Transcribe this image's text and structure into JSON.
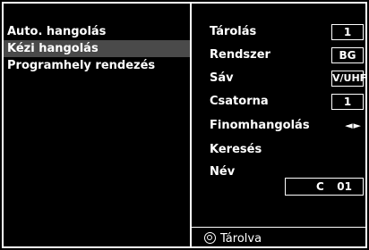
{
  "left_menu": {
    "items": [
      {
        "label": "Auto. hangolás",
        "selected": false
      },
      {
        "label": "Kézi hangolás",
        "selected": true
      },
      {
        "label": "Programhely rendezés",
        "selected": false
      }
    ]
  },
  "settings": {
    "storage": {
      "label": "Tárolás",
      "value": "1"
    },
    "system": {
      "label": "Rendszer",
      "value": "BG"
    },
    "band": {
      "label": "Sáv",
      "value": "V/UHF"
    },
    "channel": {
      "label": "Csatorna",
      "value": "1"
    },
    "fine_tuning": {
      "label": "Finomhangolás",
      "arrows": "◄►"
    },
    "search": {
      "label": "Keresés"
    },
    "name": {
      "label": "Név",
      "prefix": "C",
      "number": "01"
    }
  },
  "status": {
    "icon": "ok-button-icon",
    "text": "Tárolva"
  },
  "colors": {
    "background": "#000000",
    "foreground": "#ffffff",
    "highlight": "#4a4a4a"
  }
}
